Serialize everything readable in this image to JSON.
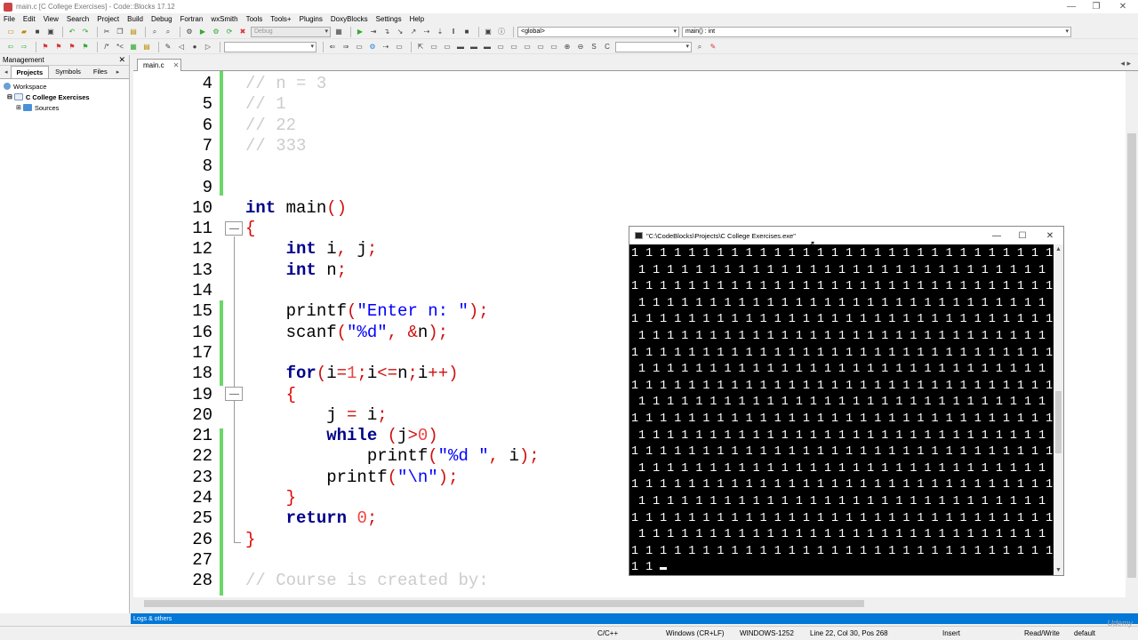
{
  "window": {
    "title": "main.c [C College Exercises] - Code::Blocks 17.12",
    "minimize": "—",
    "maximize": "❐",
    "close": "✕"
  },
  "menu": [
    "File",
    "Edit",
    "View",
    "Search",
    "Project",
    "Build",
    "Debug",
    "Fortran",
    "wxSmith",
    "Tools",
    "Tools+",
    "Plugins",
    "DoxyBlocks",
    "Settings",
    "Help"
  ],
  "toolbar": {
    "build_target": "Debug",
    "scope": "<global>",
    "function": "main() : int"
  },
  "management": {
    "title": "Management",
    "close": "✕",
    "tabs": [
      "Projects",
      "Symbols",
      "Files"
    ],
    "tree": {
      "workspace": "Workspace",
      "project": "C College Exercises",
      "sources": "Sources"
    }
  },
  "editor": {
    "tab_label": "main.c",
    "tab_close": "✕",
    "lines": [
      {
        "n": "4",
        "t": "// n = 3"
      },
      {
        "n": "5",
        "t": "// 1"
      },
      {
        "n": "6",
        "t": "// 22"
      },
      {
        "n": "7",
        "t": "// 333"
      },
      {
        "n": "8",
        "t": ""
      },
      {
        "n": "9",
        "t": ""
      },
      {
        "n": "10",
        "t": "int main()"
      },
      {
        "n": "11",
        "t": "{"
      },
      {
        "n": "12",
        "t": "    int i, j;"
      },
      {
        "n": "13",
        "t": "    int n;"
      },
      {
        "n": "14",
        "t": ""
      },
      {
        "n": "15",
        "t": "    printf(\"Enter n: \");"
      },
      {
        "n": "16",
        "t": "    scanf(\"%d\", &n);"
      },
      {
        "n": "17",
        "t": ""
      },
      {
        "n": "18",
        "t": "    for(i=1;i<=n;i++)"
      },
      {
        "n": "19",
        "t": "    {"
      },
      {
        "n": "20",
        "t": "        j = i;"
      },
      {
        "n": "21",
        "t": "        while (j>0)"
      },
      {
        "n": "22",
        "t": "            printf(\"%d \", i);"
      },
      {
        "n": "23",
        "t": "        printf(\"\\n\");"
      },
      {
        "n": "24",
        "t": "    }"
      },
      {
        "n": "25",
        "t": "    return 0;"
      },
      {
        "n": "26",
        "t": "}"
      },
      {
        "n": "27",
        "t": ""
      },
      {
        "n": "28",
        "t": "// Course is created by:"
      }
    ]
  },
  "console": {
    "title": "\"C:\\CodeBlocks\\Projects\\C College Exercises.exe\"",
    "minimize": "—",
    "maximize": "☐",
    "close": "✕",
    "row_even": "1 1 1 1 1 1 1 1 1 1 1 1 1 1 1 1 1 1 1 1 1 1 1 1 1 1 1 1 1 1",
    "row_odd": " 1 1 1 1 1 1 1 1 1 1 1 1 1 1 1 1 1 1 1 1 1 1 1 1 1 1 1 1 1 1",
    "last_line": "1 1 "
  },
  "logs_tab": "Logs & others",
  "status": {
    "lang": "C/C++",
    "eol": "Windows (CR+LF)",
    "encoding": "WINDOWS-1252",
    "position": "Line 22, Col 30, Pos 268",
    "mode": "Insert",
    "access": "Read/Write",
    "profile": "default"
  },
  "watermark": "Udemy"
}
